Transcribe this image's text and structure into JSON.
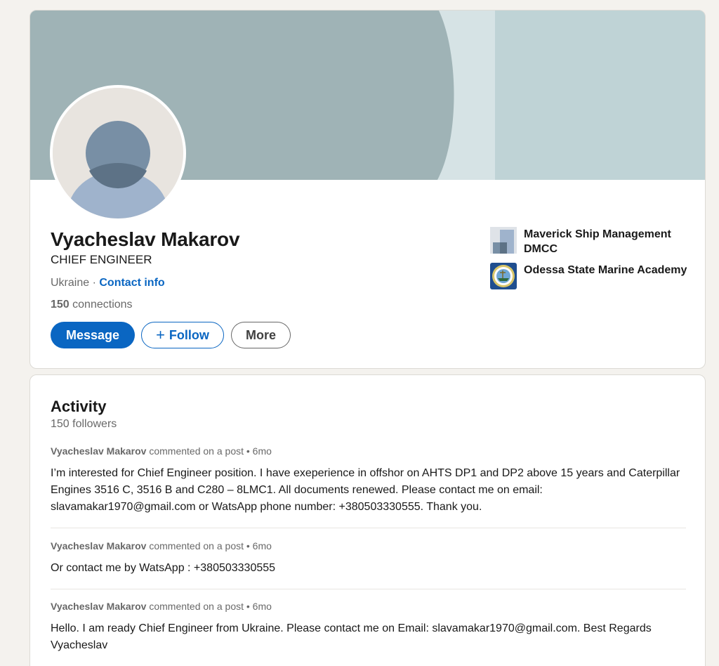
{
  "profile": {
    "name": "Vyacheslav Makarov",
    "headline": "CHIEF ENGINEER",
    "location": "Ukraine",
    "separator": " · ",
    "contact_info": "Contact info",
    "connections_count": "150",
    "connections_label": " connections"
  },
  "actions": {
    "message": "Message",
    "follow": "Follow",
    "more": "More"
  },
  "organizations": [
    {
      "name": "Maverick Ship Management DMCC",
      "icon": "company-logo-icon"
    },
    {
      "name": "Odessa State Marine Academy",
      "icon": "academy-seal-icon"
    }
  ],
  "activity": {
    "title": "Activity",
    "followers": "150 followers",
    "posts": [
      {
        "author": "Vyacheslav Makarov",
        "action": " commented on a post • 6mo",
        "text": "I’m interested for Chief Engineer position. I have exeperience in offshor on AHTS DP1 and DP2 above 15 years and Caterpillar Engines 3516 C, 3516 B and C280 – 8LMC1. All documents renewed. Please contact me on email: slavamakar1970@gmail.com or WatsApp phone number: +380503330555. Thank you."
      },
      {
        "author": "Vyacheslav Makarov",
        "action": " commented on a post • 6mo",
        "text": "Or contact me by WatsApp : +380503330555"
      },
      {
        "author": "Vyacheslav Makarov",
        "action": " commented on a post • 6mo",
        "text": "Hello. I am ready Chief Engineer from Ukraine. Please contact me on Email: slavamakar1970@gmail.com. Best Regards Vyacheslav"
      }
    ]
  },
  "colors": {
    "brand_blue": "#0a66c2",
    "page_bg": "#f4f2ee",
    "banner_dark": "#9fb3b6",
    "banner_light": "#bfd3d6"
  }
}
